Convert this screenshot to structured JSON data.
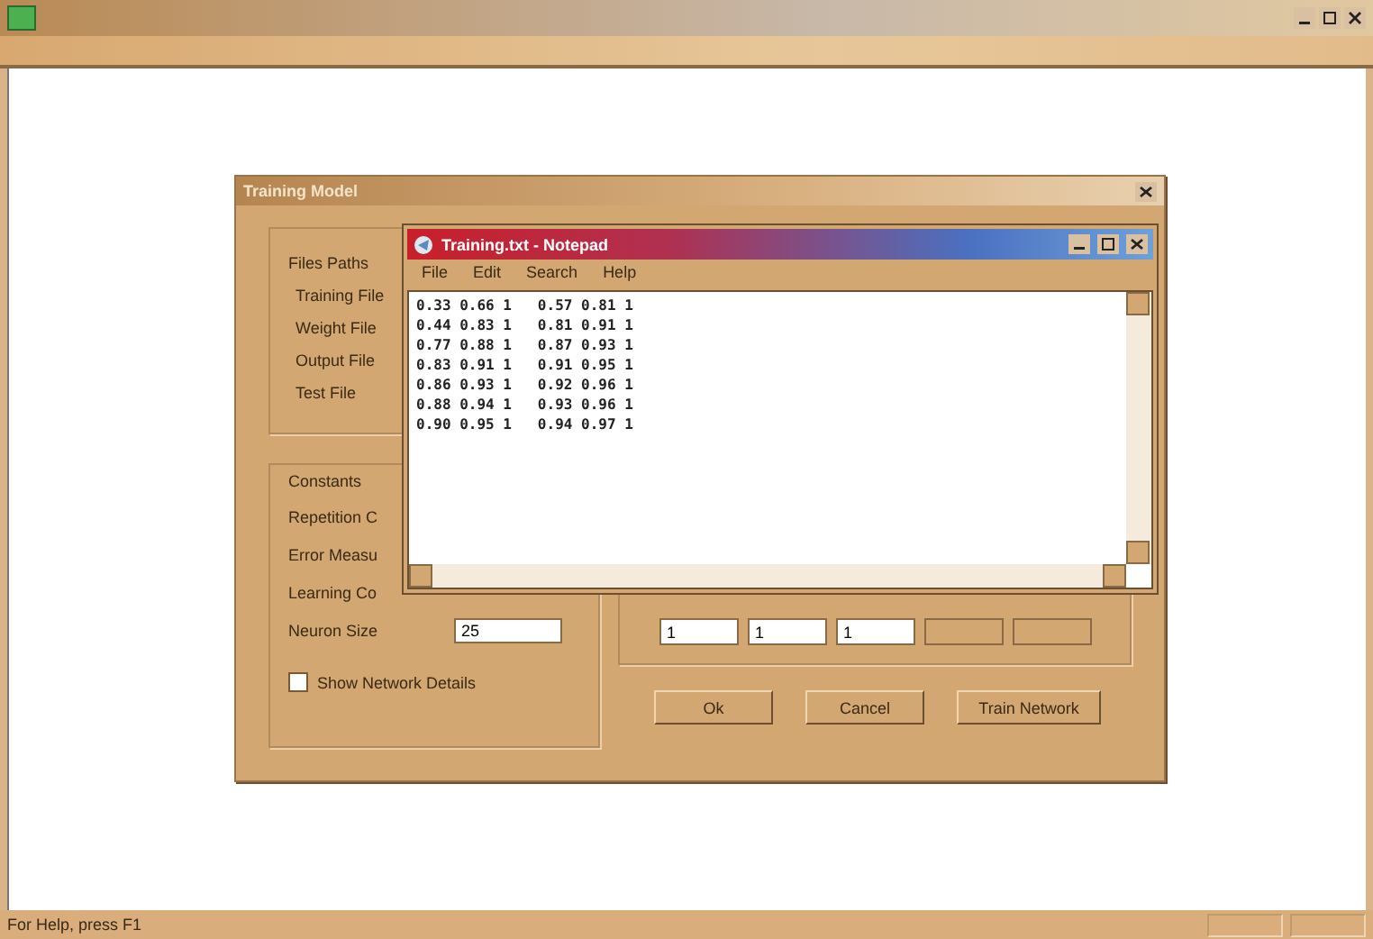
{
  "main_window": {
    "status_bar": {
      "text": "For Help, press F1"
    }
  },
  "dialog": {
    "title": "Training Model",
    "files_group": {
      "title": "Files Paths",
      "labels": [
        "Training File",
        "Weight File",
        "Output File",
        "Test File"
      ]
    },
    "constants_group": {
      "title": "Constants",
      "rows": [
        {
          "label": "Repetition C"
        },
        {
          "label": "Error Measu"
        },
        {
          "label": "Learning Co"
        },
        {
          "label": "Neuron Size",
          "value": "25"
        }
      ]
    },
    "show_details": {
      "label": "Show Network Details",
      "checked": false
    },
    "small_fields": [
      {
        "value": "1",
        "disabled": false
      },
      {
        "value": "1",
        "disabled": false
      },
      {
        "value": "1",
        "disabled": false
      },
      {
        "disabled": true
      },
      {
        "disabled": true
      }
    ],
    "buttons": [
      "Ok",
      "Cancel",
      "Train Network"
    ]
  },
  "notepad": {
    "title": "Training.txt - Notepad",
    "menu": [
      "File",
      "Edit",
      "Search",
      "Help"
    ],
    "lines": [
      "0.33 0.66 1   0.57 0.81 1",
      "0.44 0.83 1   0.81 0.91 1",
      "0.77 0.88 1   0.87 0.93 1",
      "0.83 0.91 1   0.91 0.95 1",
      "0.86 0.93 1   0.92 0.96 1",
      "0.88 0.94 1   0.93 0.96 1",
      "0.90 0.95 1   0.94 0.97 1"
    ]
  }
}
